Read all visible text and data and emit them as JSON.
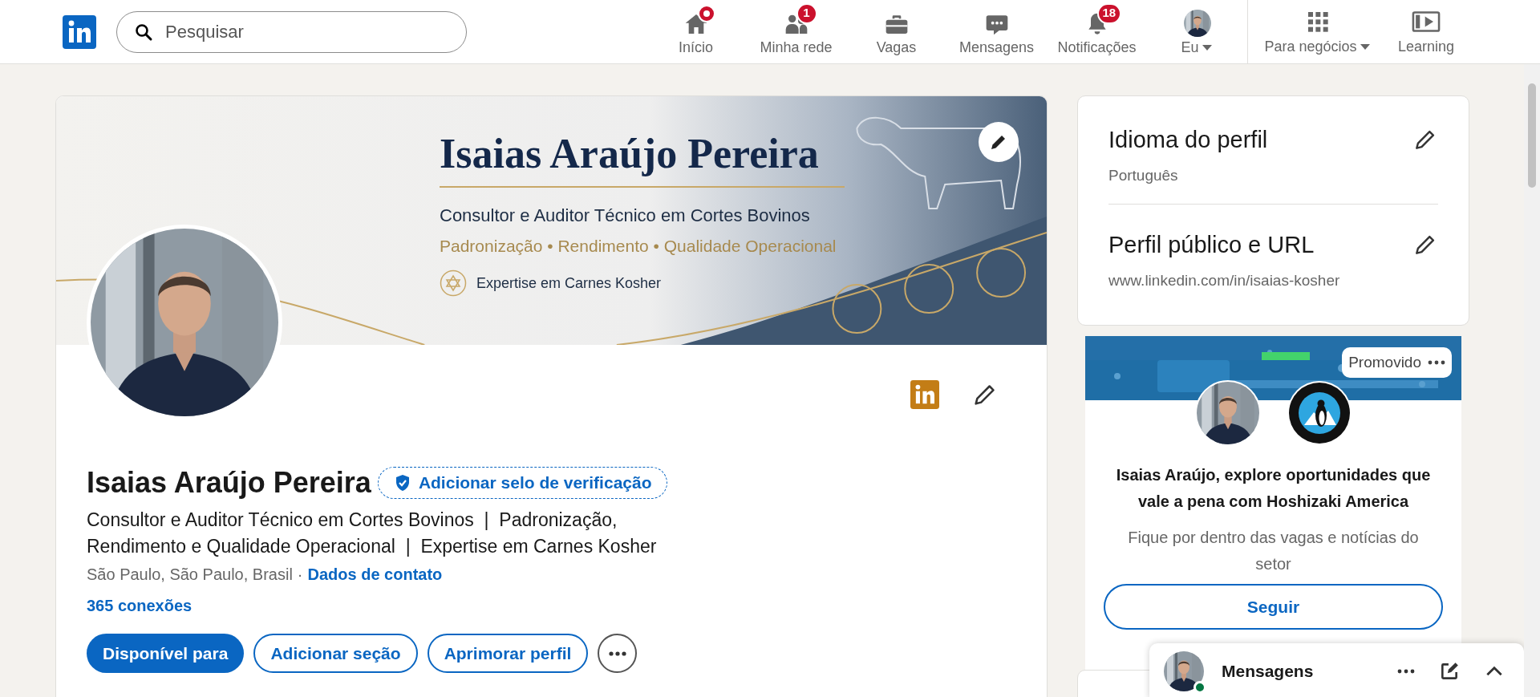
{
  "nav": {
    "search_placeholder": "Pesquisar",
    "items": [
      {
        "kind": "home",
        "label": "Início",
        "badge": {
          "kind": "dot"
        }
      },
      {
        "kind": "network",
        "label": "Minha rede",
        "badge": {
          "kind": "count",
          "text": "1"
        }
      },
      {
        "kind": "jobs",
        "label": "Vagas"
      },
      {
        "kind": "messages",
        "label": "Mensagens"
      },
      {
        "kind": "notifications",
        "label": "Notificações",
        "badge": {
          "kind": "count",
          "text": "18"
        }
      },
      {
        "kind": "me",
        "label": "Eu",
        "dropdown": true
      }
    ],
    "business": {
      "label": "Para negócios",
      "dropdown": true
    },
    "learning": {
      "label": "Learning"
    }
  },
  "profile": {
    "banner": {
      "title": "Isaias Araújo Pereira",
      "subtitle": "Consultor e Auditor Técnico em Cortes Bovinos",
      "tagline": "Padronização • Rendimento • Qualidade Operacional",
      "badge_text": "Expertise em Carnes Kosher"
    },
    "name": "Isaias Araújo Pereira",
    "verify_label": "Adicionar selo de verificação",
    "headline": "Consultor e Auditor Técnico em Cortes Bovinos  |  Padronização, Rendimento e Qualidade Operacional  |  Expertise em Carnes Kosher",
    "location": "São Paulo, São Paulo, Brasil",
    "location_separator": "·",
    "contact_link": "Dados de contato",
    "connections": "365 conexões",
    "buttons": [
      {
        "kind": "primary",
        "label": "Disponível para"
      },
      {
        "kind": "outline",
        "label": "Adicionar seção"
      },
      {
        "kind": "outline",
        "label": "Aprimorar perfil"
      },
      {
        "kind": "more"
      }
    ]
  },
  "sidebar": {
    "settings": [
      {
        "title": "Idioma do perfil",
        "value": "Português"
      },
      {
        "title": "Perfil público e URL",
        "value": "www.linkedin.com/in/isaias-kosher"
      }
    ],
    "ad": {
      "promoted_label": "Promovido",
      "headline": "Isaias Araújo, explore oportunidades que vale a pena com Hoshizaki America",
      "description": "Fique por dentro das vagas e notícias do setor",
      "follow_label": "Seguir"
    }
  },
  "messaging": {
    "title": "Mensagens",
    "online": true
  }
}
